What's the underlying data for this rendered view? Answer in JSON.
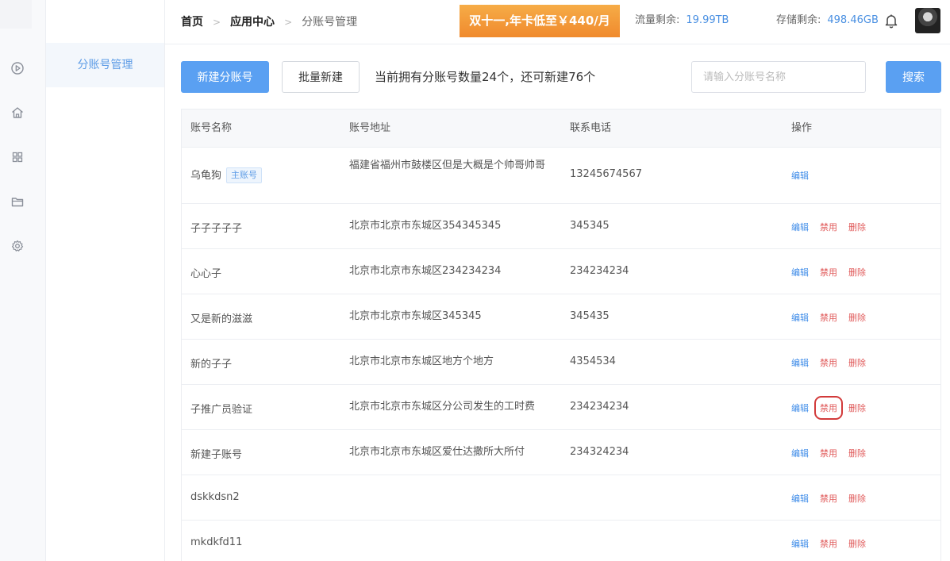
{
  "breadcrumb": {
    "home": "首页",
    "app_center": "应用中心",
    "current": "分账号管理"
  },
  "promo": "双十一,年卡低至￥440/月",
  "traffic": {
    "label": "流量剩余:",
    "value": "19.99TB"
  },
  "storage": {
    "label": "存储剩余:",
    "value": "498.46GB"
  },
  "sidebar": {
    "active_item": "分账号管理"
  },
  "toolbar": {
    "new_button": "新建分账号",
    "batch_button": "批量新建",
    "summary": "当前拥有分账号数量24个，还可新建76个",
    "search_placeholder": "请输入分账号名称",
    "search_button": "搜索"
  },
  "table": {
    "headers": {
      "name": "账号名称",
      "address": "账号地址",
      "phone": "联系电话",
      "ops": "操作"
    },
    "ops_labels": {
      "edit": "编辑",
      "disable": "禁用",
      "delete": "删除"
    },
    "main_tag": "主账号",
    "rows": [
      {
        "name": "乌龟狗",
        "address": "福建省福州市鼓楼区但是大概是个帅哥帅哥",
        "phone": "13245674567"
      },
      {
        "name": "子子子子子",
        "address": "北京市北京市东城区354345345",
        "phone": "345345"
      },
      {
        "name": "心心子",
        "address": "北京市北京市东城区234234234",
        "phone": "234234234"
      },
      {
        "name": "又是新的滋滋",
        "address": "北京市北京市东城区345345",
        "phone": "345435"
      },
      {
        "name": "新的子子",
        "address": "北京市北京市东城区地方个地方",
        "phone": "4354534"
      },
      {
        "name": "子推广员验证",
        "address": "北京市北京市东城区分公司发生的工时费",
        "phone": "234234234"
      },
      {
        "name": "新建子账号",
        "address": "北京市北京市东城区爱仕达撒所大所付",
        "phone": "234324234"
      },
      {
        "name": "dskkdsn2",
        "address": "",
        "phone": ""
      },
      {
        "name": "mkdkfd11",
        "address": "",
        "phone": ""
      }
    ]
  }
}
